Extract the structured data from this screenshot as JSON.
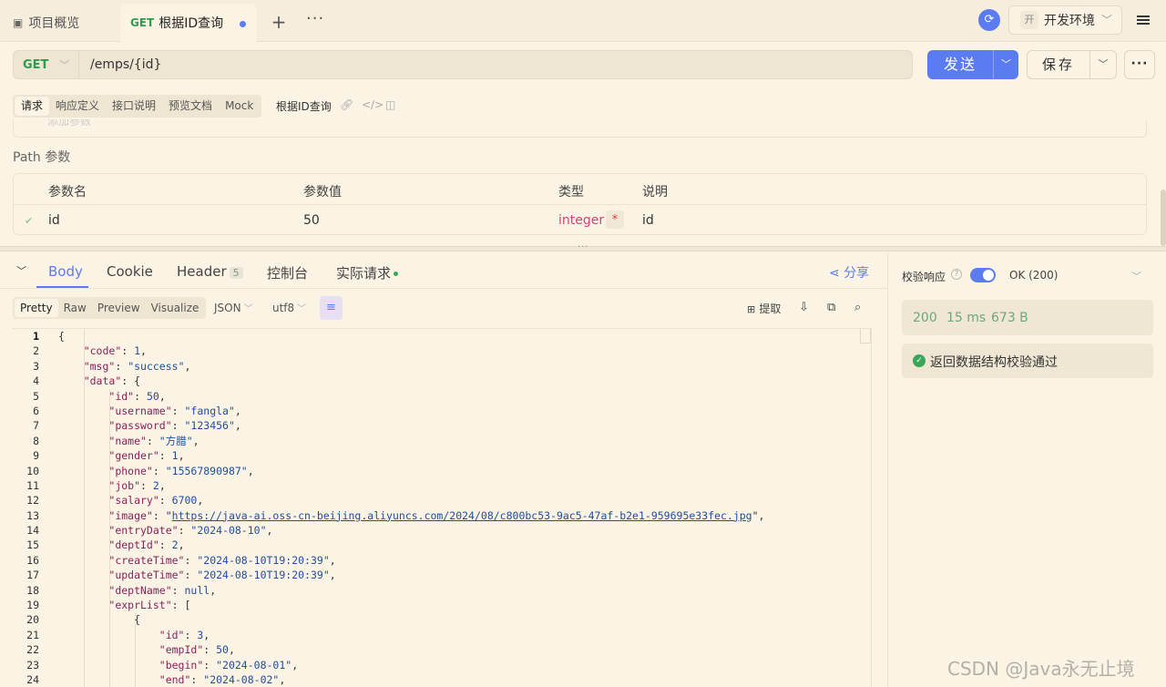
{
  "tabs": {
    "overview": "项目概览",
    "active_method": "GET",
    "active_label": "根据ID查询",
    "plus": "+",
    "more": "···"
  },
  "env": {
    "badge": "开",
    "label": "开发环境"
  },
  "request": {
    "method": "GET",
    "url": "/emps/{id}",
    "send_label": "发送",
    "save_label": "保存",
    "more": "···"
  },
  "req_tabs": [
    "请求",
    "响应定义",
    "接口说明",
    "预览文档",
    "Mock"
  ],
  "api_name": "根据ID查询",
  "params_hint": "添加参数",
  "path_params": {
    "title": "Path 参数",
    "headers": [
      "参数名",
      "参数值",
      "类型",
      "说明"
    ],
    "row": {
      "name": "id",
      "value": "50",
      "type": "integer",
      "required": "*",
      "desc": "id"
    }
  },
  "resp_tabs": {
    "body": "Body",
    "cookie": "Cookie",
    "header": "Header",
    "header_count": "5",
    "console": "控制台",
    "actual": "实际请求",
    "share": "分享"
  },
  "format_tabs": [
    "Pretty",
    "Raw",
    "Preview",
    "Visualize"
  ],
  "format_select": "JSON",
  "encoding_select": "utf8",
  "extract_label": "提取",
  "validation": {
    "label": "校验响应",
    "status": "OK (200)",
    "code": "200",
    "time": "15 ms",
    "size": "673 B",
    "pass_text": "返回数据结构校验通过"
  },
  "watermark": "CSDN @Java永无止境",
  "colors": {
    "accent": "#5b7cf0",
    "get_method": "#2e9b4f",
    "integer_type": "#e03b7a",
    "success": "#3aa65a"
  },
  "code_lines": [
    "{",
    "    \"code\": 1,",
    "    \"msg\": \"success\",",
    "    \"data\": {",
    "        \"id\": 50,",
    "        \"username\": \"fangla\",",
    "        \"password\": \"123456\",",
    "        \"name\": \"方腊\",",
    "        \"gender\": 1,",
    "        \"phone\": \"15567890987\",",
    "        \"job\": 2,",
    "        \"salary\": 6700,",
    "        \"image\": \"https://java-ai.oss-cn-beijing.aliyuncs.com/2024/08/c800bc53-9ac5-47af-b2e1-959695e33fec.jpg\",",
    "        \"entryDate\": \"2024-08-10\",",
    "        \"deptId\": 2,",
    "        \"createTime\": \"2024-08-10T19:20:39\",",
    "        \"updateTime\": \"2024-08-10T19:20:39\",",
    "        \"deptName\": null,",
    "        \"exprList\": [",
    "            {",
    "                \"id\": 3,",
    "                \"empId\": 50,",
    "                \"begin\": \"2024-08-01\",",
    "                \"end\": \"2024-08-02\","
  ]
}
